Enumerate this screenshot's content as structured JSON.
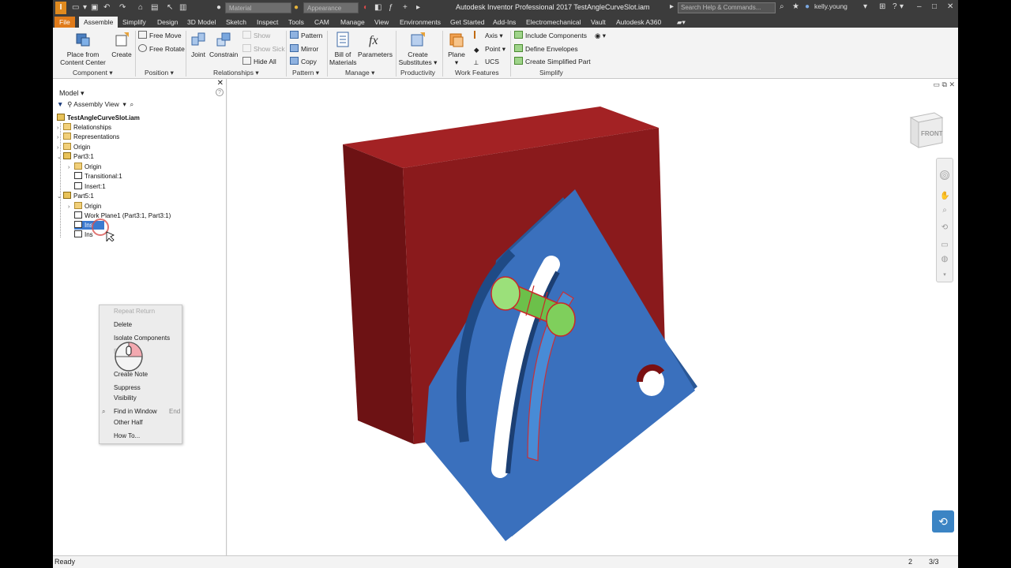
{
  "title_bar": {
    "app_title": "Autodesk Inventor Professional 2017    TestAngleCurveSlot.iam",
    "material_placeholder": "Material",
    "appearance_placeholder": "Appearance",
    "search_placeholder": "Search Help & Commands...",
    "user": "kelly.young"
  },
  "tabs": [
    "File",
    "Assemble",
    "Simplify",
    "Design",
    "3D Model",
    "Sketch",
    "Inspect",
    "Tools",
    "CAM",
    "Manage",
    "View",
    "Environments",
    "Get Started",
    "Add-Ins",
    "Electromechanical",
    "Vault",
    "Autodesk A360"
  ],
  "ribbon": {
    "component": {
      "title": "Component",
      "place": [
        "Place from",
        "Content Center"
      ],
      "create": "Create"
    },
    "position": {
      "title": "Position",
      "free_move": "Free Move",
      "free_rotate": "Free Rotate"
    },
    "relationships": {
      "title": "Relationships",
      "joint": "Joint",
      "constrain": "Constrain",
      "show": "Show",
      "show_sick": "Show Sick",
      "hide_all": "Hide All"
    },
    "pattern": {
      "title": "Pattern",
      "pattern": "Pattern",
      "mirror": "Mirror",
      "copy": "Copy"
    },
    "manage": {
      "title": "Manage",
      "bom": [
        "Bill of",
        "Materials"
      ],
      "parameters": "Parameters"
    },
    "productivity": {
      "title": "Productivity",
      "create_substitutes": [
        "Create",
        "Substitutes"
      ]
    },
    "work_features": {
      "title": "Work Features",
      "plane": "Plane",
      "axis": "Axis",
      "point": "Point",
      "ucs": "UCS"
    },
    "simplify": {
      "title": "Simplify",
      "include": "Include Components",
      "envelopes": "Define Envelopes",
      "simplified": "Create Simplified Part"
    }
  },
  "browser": {
    "header": "Model",
    "view_label": "Assembly View",
    "tree": [
      {
        "label": "TestAngleCurveSlot.iam",
        "bold": true
      },
      {
        "label": "Relationships"
      },
      {
        "label": "Representations"
      },
      {
        "label": "Origin"
      },
      {
        "label": "Part3:1"
      },
      {
        "label": "Origin"
      },
      {
        "label": "Transitional:1"
      },
      {
        "label": "Insert:1"
      },
      {
        "label": "Part5:1"
      },
      {
        "label": "Origin"
      },
      {
        "label": "Work Plane1 (Part3:1, Part3:1)"
      },
      {
        "label": "Ins"
      },
      {
        "label": "Ins"
      }
    ]
  },
  "context_menu": {
    "items": [
      {
        "label": "Repeat Return",
        "dim": true
      },
      {
        "label": "Delete"
      },
      {
        "label": "Isolate Components"
      },
      {
        "label": "Edit",
        "dim": true
      },
      {
        "label": "Create Note"
      },
      {
        "label": "Suppress"
      },
      {
        "label": "Visibility"
      },
      {
        "label": "Find in Window",
        "shortcut": "End"
      },
      {
        "label": "Other Half"
      },
      {
        "label": "How To..."
      }
    ]
  },
  "viewcube": {
    "face": "FRONT"
  },
  "status": {
    "left": "Ready",
    "count": "2",
    "pages": "3/3"
  },
  "colors": {
    "red_block": "#8f1c1e",
    "blue_plate": "#2f64a8",
    "pin": "#8ed86a",
    "accent": "#e07b1a"
  }
}
